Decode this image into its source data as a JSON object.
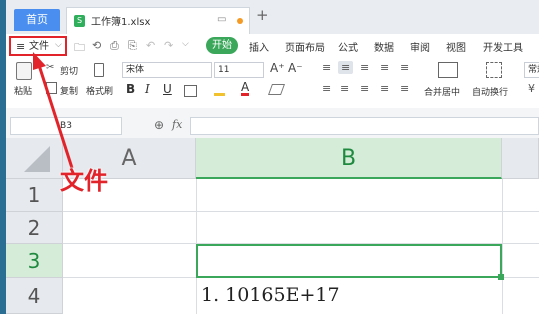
{
  "tabs": {
    "home": "首页",
    "doc_name": "工作簿1.xlsx",
    "doc_icon": "S",
    "plus": "+",
    "window_icon": "▭"
  },
  "menu": {
    "file_label": "文件",
    "file_icon": "≡",
    "file_arrow": "⌵",
    "tabs": [
      "开始",
      "插入",
      "页面布局",
      "公式",
      "数据",
      "审阅",
      "视图",
      "开发工具"
    ]
  },
  "quick_access": [
    "🗀",
    "⟲",
    "⎙",
    "⎘",
    "↶",
    "↷",
    "⌵"
  ],
  "ribbon": {
    "paste": "粘贴",
    "cut": "剪切",
    "copy": "复制",
    "format_painter": "格式刷",
    "font_name": "宋体",
    "font_size": "11",
    "grow": "A⁺",
    "shrink": "A⁻",
    "bold": "B",
    "italic": "I",
    "underline": "U",
    "merge_center": "合并居中",
    "wrap_text": "自动换行",
    "number_format": "常规"
  },
  "formula_bar": {
    "name_box": "B3",
    "fx": "fx",
    "zoom_icon": "⊕"
  },
  "grid": {
    "columns": [
      "A",
      "B"
    ],
    "rows": [
      "1",
      "2",
      "3",
      "4"
    ],
    "selected_column": "B",
    "selected_row": "3",
    "b4_value": "1. 10165E+17"
  },
  "annotation": {
    "label": "文件",
    "color": "#e2242a"
  },
  "colors": {
    "accent": "#3aa75a",
    "home_tab": "#4a8ef0",
    "highlight_border": "#e2242a"
  }
}
